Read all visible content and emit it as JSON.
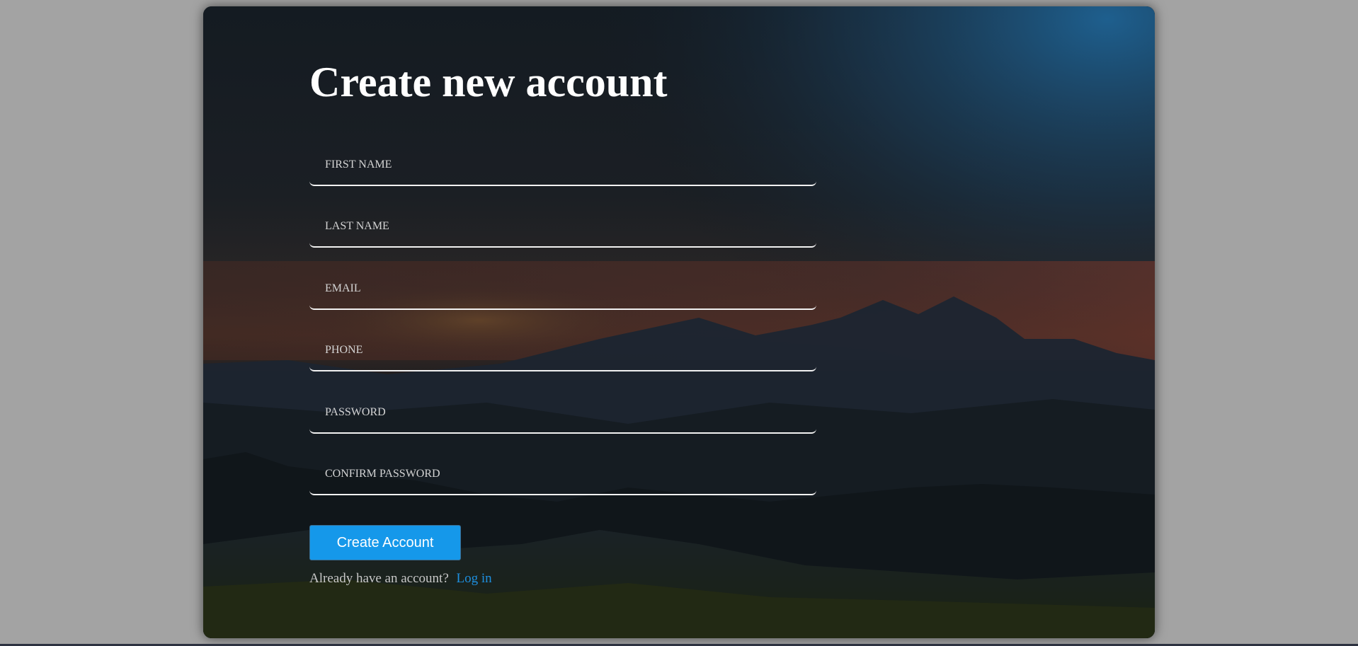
{
  "form": {
    "title": "Create new account",
    "fields": [
      {
        "name": "first-name",
        "placeholder": "FIRST NAME",
        "value": ""
      },
      {
        "name": "last-name",
        "placeholder": "LAST NAME",
        "value": ""
      },
      {
        "name": "email",
        "placeholder": "EMAIL",
        "value": ""
      },
      {
        "name": "phone",
        "placeholder": "PHONE",
        "value": ""
      },
      {
        "name": "password",
        "placeholder": "PASSWORD",
        "value": ""
      },
      {
        "name": "confirm-password",
        "placeholder": "CONFIRM PASSWORD",
        "value": ""
      }
    ],
    "submit_label": "Create Account",
    "login_prompt": "Already have an account?",
    "login_link": "Log in"
  },
  "colors": {
    "page_background": "#a3a3a3",
    "button": "#1598ea",
    "link": "#1e8fde",
    "title": "#ffffff"
  },
  "background_image": "mountain-sunset-landscape"
}
